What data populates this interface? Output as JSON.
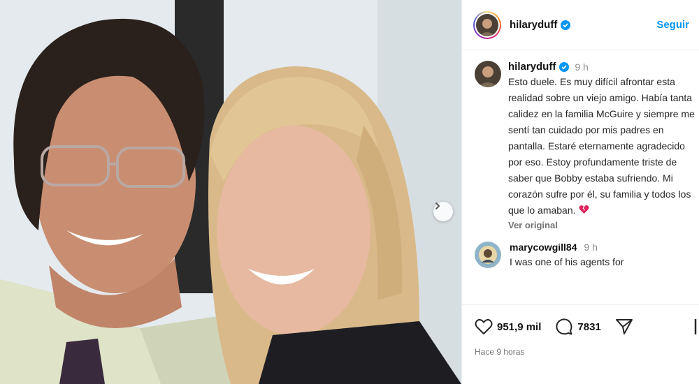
{
  "header": {
    "username": "hilaryduff",
    "follow_label": "Seguir"
  },
  "caption": {
    "username": "hilaryduff",
    "time": "9 h",
    "text": "Esto duele. Es muy difícil afrontar esta realidad sobre un viejo amigo. Había tanta calidez en la familia McGuire y siempre me sentí tan cuidado por mis padres en pantalla. Estaré eternamente agradecido por eso. Estoy profundamente triste de saber que Bobby estaba sufriendo. Mi corazón sufre por él, su familia y todos los que lo amaban.",
    "see_original": "Ver original"
  },
  "comment": {
    "username": "marycowgill84",
    "time": "9 h",
    "text": "I was one of his agents for"
  },
  "actions": {
    "likes": "951,9 mil",
    "comments": "7831",
    "time_ago": "Hace 9 horas"
  },
  "colors": {
    "accent": "#0095f6",
    "verified": "#0095f6",
    "broken_heart": "#e0245e"
  },
  "icons": [
    "verified-badge-icon",
    "broken-heart-icon",
    "heart-icon",
    "comment-icon",
    "share-icon",
    "chevron-right-icon",
    "bookmark-icon"
  ]
}
